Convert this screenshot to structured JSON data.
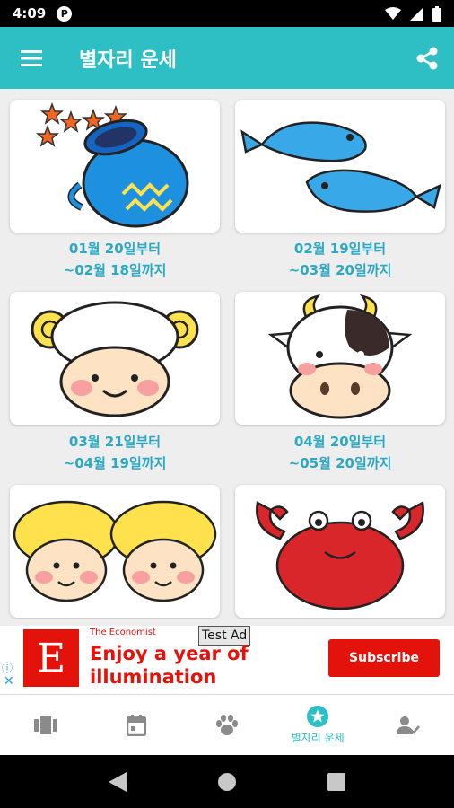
{
  "status_bar": {
    "time": "4:09",
    "badge": "P"
  },
  "app_bar": {
    "title": "별자리 운세"
  },
  "signs": [
    {
      "icon": "aquarius-illustration",
      "line1": "01월 20일부터",
      "line2": "~02월 18일까지"
    },
    {
      "icon": "pisces-illustration",
      "line1": "02월 19일부터",
      "line2": "~03월 20일까지"
    },
    {
      "icon": "aries-illustration",
      "line1": "03월 21일부터",
      "line2": "~04월 19일까지"
    },
    {
      "icon": "taurus-illustration",
      "line1": "04월 20일부터",
      "line2": "~05월 20일까지"
    },
    {
      "icon": "gemini-illustration"
    },
    {
      "icon": "cancer-illustration"
    }
  ],
  "ad": {
    "brand": "The Economist",
    "logo_letter": "E",
    "test_label": "Test Ad",
    "headline": "Enjoy a year of illumination",
    "cta": "Subscribe",
    "info_glyph": "ⓘ",
    "close_glyph": "✕"
  },
  "bottom_nav": [
    {
      "icon": "cards-icon",
      "label": ""
    },
    {
      "icon": "calendar-icon",
      "label": ""
    },
    {
      "icon": "paw-icon",
      "label": ""
    },
    {
      "icon": "star-circle-icon",
      "label": "별자리 운세",
      "active": true
    },
    {
      "icon": "person-check-icon",
      "label": ""
    }
  ],
  "colors": {
    "accent": "#2ebfc4",
    "caption": "#2aa8c4",
    "ad_red": "#e3120b",
    "nav_inactive": "#8a8a8a"
  }
}
